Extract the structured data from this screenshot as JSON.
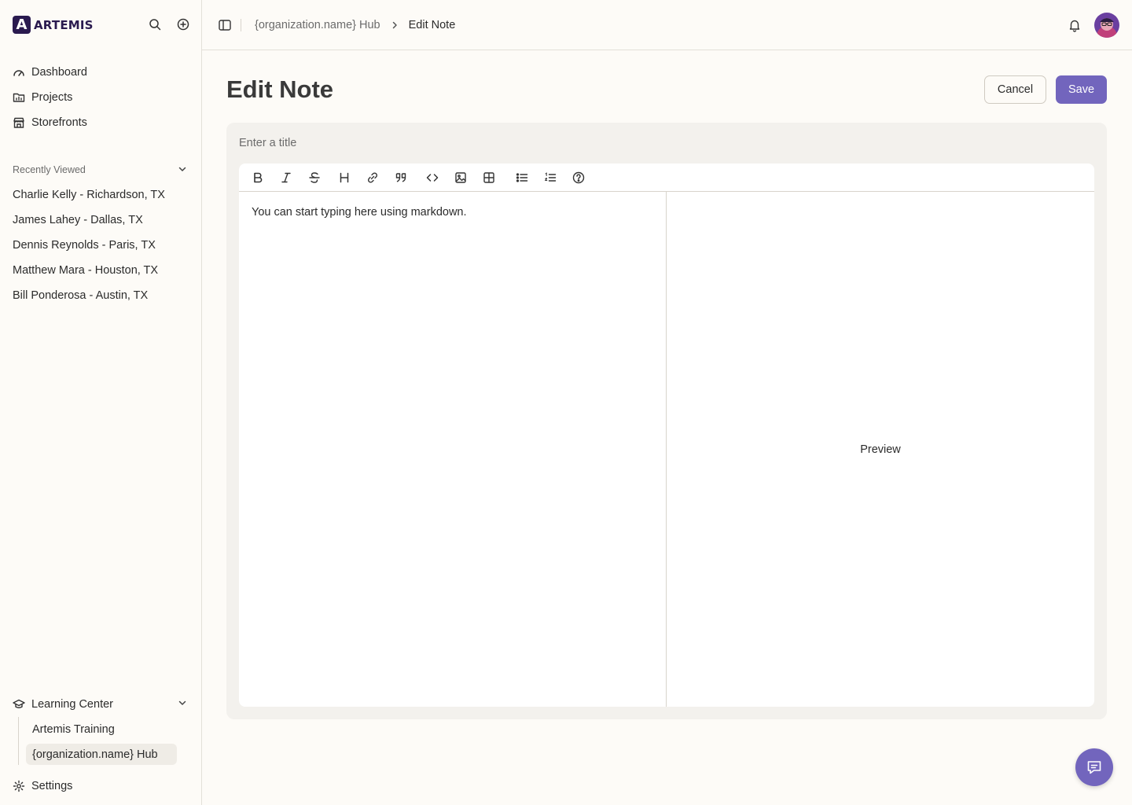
{
  "app": {
    "logo_letter": "A",
    "logo_text": "ARTEMIS",
    "accent": "#7265bd",
    "brand": "#2a1a4f"
  },
  "sidebar": {
    "nav": [
      {
        "label": "Dashboard",
        "icon": "gauge-icon"
      },
      {
        "label": "Projects",
        "icon": "folder-chart-icon"
      },
      {
        "label": "Storefronts",
        "icon": "store-icon"
      }
    ],
    "recent_title": "Recently Viewed",
    "recent": [
      "Charlie Kelly - Richardson, TX",
      "James Lahey - Dallas, TX",
      "Dennis Reynolds - Paris, TX",
      "Matthew Mara - Houston, TX",
      "Bill Ponderosa - Austin, TX"
    ],
    "learning": {
      "title": "Learning Center",
      "items": [
        "Artemis Training",
        "{organization.name} Hub"
      ],
      "active_index": 1
    },
    "settings_label": "Settings"
  },
  "topbar": {
    "breadcrumb": {
      "parent": "{organization.name} Hub",
      "current": "Edit Note"
    }
  },
  "page": {
    "title": "Edit Note",
    "cancel_label": "Cancel",
    "save_label": "Save",
    "title_placeholder": "Enter a title",
    "editor_placeholder": "You can start typing here using markdown.",
    "preview_label": "Preview",
    "toolbar": [
      "bold-icon",
      "italic-icon",
      "strikethrough-icon",
      "heading-icon",
      "link-icon",
      "quote-icon",
      "code-icon",
      "image-icon",
      "table-icon",
      "bullet-list-icon",
      "numbered-list-icon",
      "help-icon"
    ]
  }
}
